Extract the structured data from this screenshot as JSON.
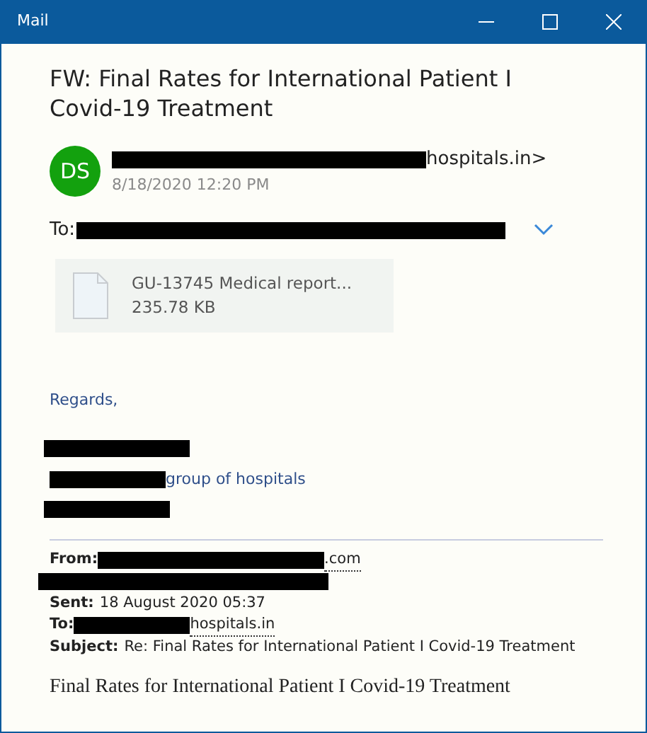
{
  "window": {
    "title": "Mail"
  },
  "message": {
    "subject": "FW: Final Rates for International Patient I Covid-19 Treatment",
    "sender": {
      "initials": "DS",
      "color": "#13a10e",
      "address_tail": "hospitals.in>",
      "date": "8/18/2020 12:20 PM"
    },
    "to_label": "To:",
    "attachment": {
      "name": "GU-13745 Medical report...",
      "size": "235.78 KB"
    },
    "signature": {
      "greeting": "Regards,",
      "org_tail": "group of hospitals"
    },
    "quoted": {
      "from_label": "From:",
      "from_tail": ".com",
      "sent_label": "Sent:",
      "sent": "18 August 2020 05:37",
      "to_label": "To:",
      "to_tail": "hospitals.in",
      "subject_label": "Subject:",
      "subject": "Re: Final Rates for International Patient I Covid-19 Treatment"
    },
    "body": "Final Rates for International Patient I Covid-19 Treatment"
  }
}
